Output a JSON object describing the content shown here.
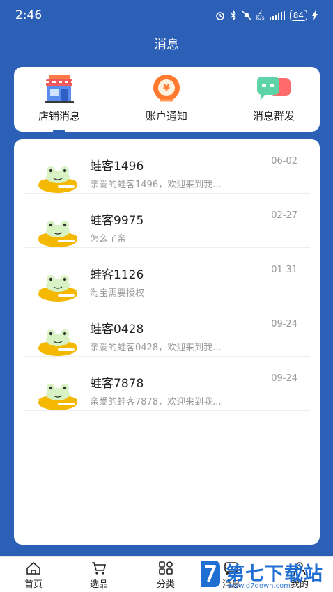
{
  "status_bar": {
    "time": "2:46",
    "battery": "84",
    "net_speed_top": "2",
    "net_speed_bottom": "K/s"
  },
  "header": {
    "title": "消息"
  },
  "tabs": [
    {
      "label": "店铺消息",
      "icon": "shop-icon",
      "active": true
    },
    {
      "label": "账户通知",
      "icon": "coin-icon",
      "active": false
    },
    {
      "label": "消息群发",
      "icon": "chat-bubbles-icon",
      "active": false
    }
  ],
  "messages": [
    {
      "name": "蛙客1496",
      "preview": "亲爱的蛙客1496，欢迎来到我...",
      "date": "06-02"
    },
    {
      "name": "蛙客9975",
      "preview": "怎么了亲",
      "date": "02-27"
    },
    {
      "name": "蛙客1126",
      "preview": "淘宝需要授权",
      "date": "01-31"
    },
    {
      "name": "蛙客0428",
      "preview": "亲爱的蛙客0428，欢迎来到我...",
      "date": "09-24"
    },
    {
      "name": "蛙客7878",
      "preview": "亲爱的蛙客7878，欢迎来到我...",
      "date": "09-24"
    }
  ],
  "bottom_nav": [
    {
      "label": "首页",
      "icon": "home-icon"
    },
    {
      "label": "选品",
      "icon": "cart-icon"
    },
    {
      "label": "分类",
      "icon": "grid-icon"
    },
    {
      "label": "消息",
      "icon": "message-icon"
    },
    {
      "label": "我的",
      "icon": "profile-icon"
    }
  ],
  "watermark": {
    "text": "第七下载站",
    "url": "www.d7down.com"
  },
  "colors": {
    "brand_blue": "#2c5fb6",
    "frog_yellow": "#f5b800",
    "frog_green": "#b8e6a0"
  }
}
